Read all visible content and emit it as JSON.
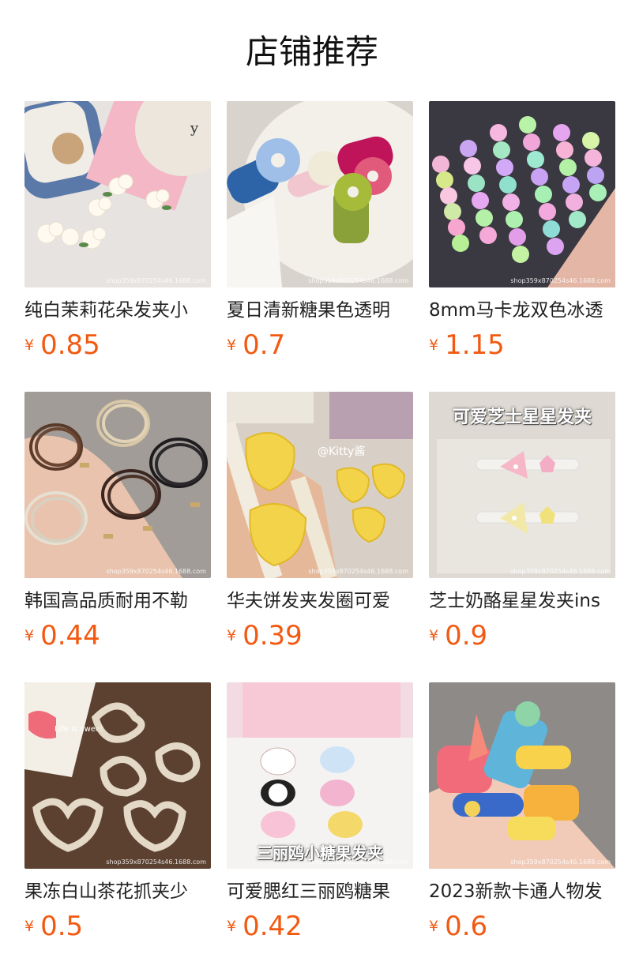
{
  "page": {
    "title": "店铺推荐"
  },
  "colors": {
    "price": "#f25a12",
    "title_text": "#222222"
  },
  "products": [
    {
      "title": "纯白茉莉花朵发夹小",
      "currency": "¥",
      "price": "0.85",
      "watermark": "shop359x870254s46.1688.com",
      "image": "white-flower-hair-clips"
    },
    {
      "title": "夏日清新糖果色透明",
      "currency": "¥",
      "price": "0.7",
      "watermark": "shop359x870254s46.1688.com",
      "image": "candy-color-flower-clips"
    },
    {
      "title": "8mm马卡龙双色冰透",
      "currency": "¥",
      "price": "1.15",
      "watermark": "shop359x870254s46.1688.com",
      "image": "macaron-bead-bracelets"
    },
    {
      "title": "韩国高品质耐用不勒",
      "currency": "¥",
      "price": "0.44",
      "watermark": "shop359x870254s46.1688.com",
      "image": "hair-ties-bundle"
    },
    {
      "title": "华夫饼发夹发圈可爱",
      "currency": "¥",
      "price": "0.39",
      "watermark": "shop359x870254s46.1688.com",
      "image": "waffle-kitty-clips",
      "overlay": "@Kitty酱"
    },
    {
      "title": "芝士奶酪星星发夹ins",
      "currency": "¥",
      "price": "0.9",
      "watermark": "shop359x870254s46.1688.com",
      "image": "cheese-star-clips",
      "overlay": "可爱芝士星星发夹"
    },
    {
      "title": "果冻白山茶花抓夹少",
      "currency": "¥",
      "price": "0.5",
      "watermark": "shop359x870254s46.1688.com",
      "image": "jelly-camellia-claw-clips",
      "overlay": "Life is sweet"
    },
    {
      "title": "可爱腮红三丽鸥糖果",
      "currency": "¥",
      "price": "0.42",
      "watermark": "shop359x870254s46.1688.com",
      "image": "sanrio-candy-clips",
      "overlay": "三丽鸥小糖果发夹"
    },
    {
      "title": "2023新款卡通人物发",
      "currency": "¥",
      "price": "0.6",
      "watermark": "shop359x870254s46.1688.com",
      "image": "cartoon-character-clips"
    }
  ]
}
